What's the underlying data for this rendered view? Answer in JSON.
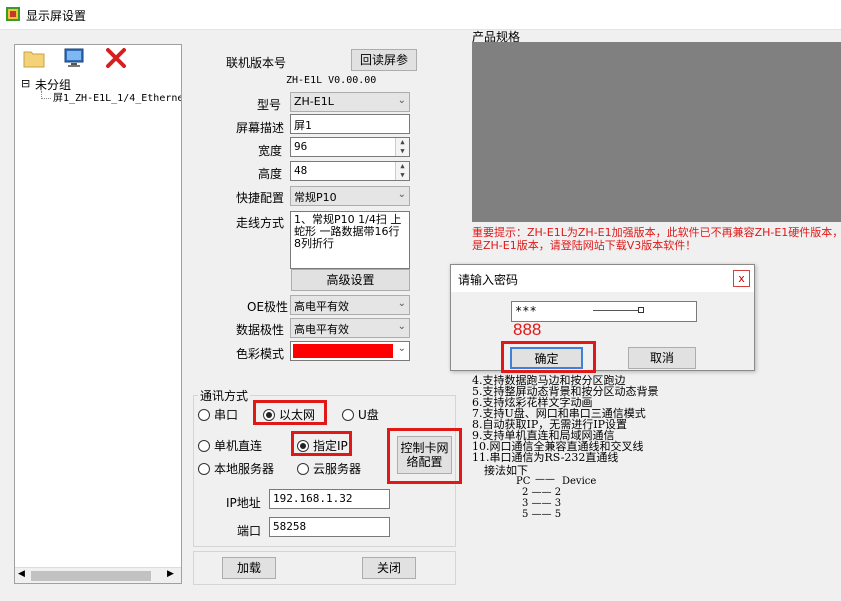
{
  "window": {
    "title": "显示屏设置"
  },
  "toolbar": {
    "open_icon": "folder-icon",
    "monitor_icon": "monitor-icon",
    "delete_icon": "delete-x-icon"
  },
  "tree": {
    "group_label": "未分组",
    "item_label": "屏1_ZH-E1L_1/4_Etherne",
    "expand_symbol": "⊟"
  },
  "form": {
    "version_label": "联机版本号",
    "readback_button": "回读屏参",
    "version_value": "ZH-E1L V0.00.00",
    "model_label": "型号",
    "model_value": "ZH-E1L",
    "desc_label": "屏幕描述",
    "desc_value": "屏1",
    "width_label": "宽度",
    "width_value": "96",
    "height_label": "高度",
    "height_value": "48",
    "quick_label": "快捷配置",
    "quick_value": "常规P10",
    "routing_label": "走线方式",
    "routing_value": "1、常规P10  1/4扫 上蛇形 一路数据带16行8列折行",
    "advanced_button": "高级设置",
    "oe_label": "OE极性",
    "oe_value": "高电平有效",
    "data_pol_label": "数据极性",
    "data_pol_value": "高电平有效",
    "color_label": "色彩模式",
    "color_swatch": "#ff0000"
  },
  "comm": {
    "group_label": "通讯方式",
    "serial": "串口",
    "ethernet": "以太网",
    "udisk": "U盘",
    "direct": "单机直连",
    "fixed_ip": "指定IP",
    "local_server": "本地服务器",
    "cloud_server": "云服务器",
    "netcard_button": "控制卡网络配置",
    "ip_label": "IP地址",
    "ip_value": "192.168.1.32",
    "port_label": "端口",
    "port_value": "58258"
  },
  "bottom": {
    "load_button": "加载",
    "close_button": "关闭"
  },
  "spec": {
    "label": "产品规格",
    "notice": "重要提示：ZH-E1L为ZH-E1加强版本，此软件已不再兼容ZH-E1硬件版本，如",
    "notice2": "是ZH-E1版本，请登陆网站下载V3版本软件！",
    "features": [
      "4.支持数据跑马边和按分区跑边",
      "5.支持整屏动态背景和按分区动态背景",
      "6.支持炫彩花样文字动画",
      "7.支持U盘、网口和串口三通信模式",
      "8.自动获取IP，无需进行IP设置",
      "9.支持单机直连和局域网通信",
      "10.网口通信全兼容直通线和交叉线",
      "11.串口通信为RS-232直通线"
    ],
    "wiring_title": "接法如下",
    "wiring_header_pc": "PC",
    "wiring_header_dev": "Device",
    "wiring": [
      "2 —— 2",
      "3 —— 3",
      "5 —— 5"
    ]
  },
  "dialog": {
    "title": "请输入密码",
    "close_symbol": "x",
    "password_value": "***",
    "annotation": "888",
    "ok_button": "确定",
    "cancel_button": "取消"
  },
  "colors": {
    "annotation_red": "#e01818",
    "preview_gray": "#808080"
  }
}
